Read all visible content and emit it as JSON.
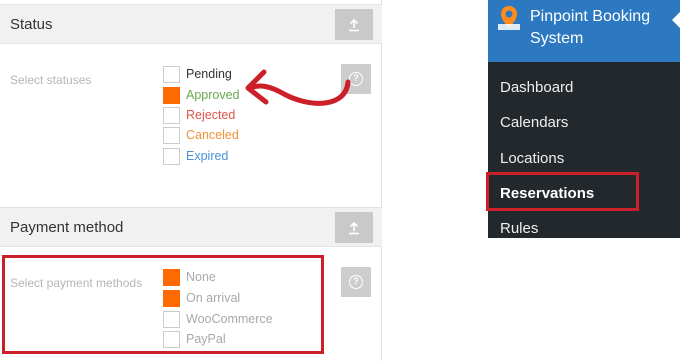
{
  "status_section": {
    "title": "Status",
    "field_label": "Select statuses",
    "options": [
      {
        "label": "Pending",
        "checked": false,
        "color": "#333333"
      },
      {
        "label": "Approved",
        "checked": true,
        "color": "#6aa84f"
      },
      {
        "label": "Rejected",
        "checked": false,
        "color": "#e0544a"
      },
      {
        "label": "Canceled",
        "checked": false,
        "color": "#f0913a"
      },
      {
        "label": "Expired",
        "checked": false,
        "color": "#4a90d9"
      }
    ],
    "help_icon": "?"
  },
  "payment_section": {
    "title": "Payment method",
    "field_label": "Select payment methods",
    "options": [
      {
        "label": "None",
        "checked": true,
        "color": "#a9a9a9"
      },
      {
        "label": "On arrival",
        "checked": true,
        "color": "#a9a9a9"
      },
      {
        "label": "WooCommerce",
        "checked": false,
        "color": "#a9a9a9"
      },
      {
        "label": "PayPal",
        "checked": false,
        "color": "#a9a9a9"
      }
    ],
    "help_icon": "?"
  },
  "sidebar": {
    "plugin_title": "Pinpoint Booking System",
    "items": [
      {
        "label": "Dashboard",
        "active": false
      },
      {
        "label": "Calendars",
        "active": false
      },
      {
        "label": "Locations",
        "active": false
      },
      {
        "label": "Reservations",
        "active": true
      },
      {
        "label": "Rules",
        "active": false
      }
    ]
  },
  "colors": {
    "accent": "#ff6a00",
    "annotation_red": "#cc1f2a",
    "wp_menu_bg": "#23282d",
    "wp_plugin_blue": "#2c79c1"
  },
  "icons": {
    "collapse": "arrow-up-icon",
    "help": "question-circle-icon",
    "logo": "map-pin-logo-icon",
    "annotation": "curved-arrow-icon"
  }
}
